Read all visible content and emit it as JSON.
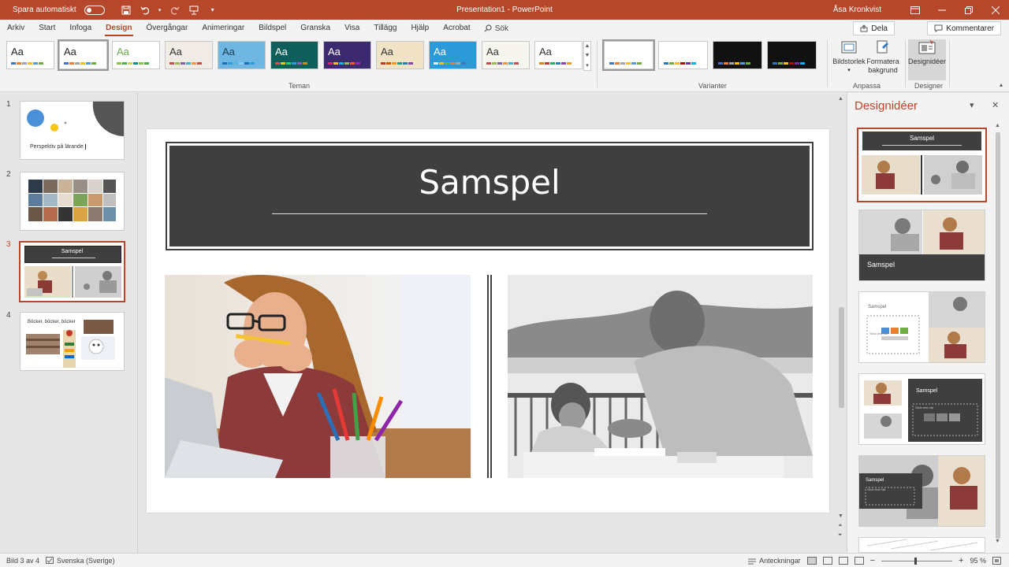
{
  "titlebar": {
    "autosave_label": "Spara automatiskt",
    "document_title": "Presentation1 - PowerPoint",
    "user": "Åsa Kronkvist",
    "icons": [
      "save-icon",
      "undo-icon",
      "redo-icon",
      "present-icon",
      "customize-icon",
      "ribbon-display-icon",
      "minimize-icon",
      "restore-icon",
      "close-icon"
    ]
  },
  "tabs": [
    "Arkiv",
    "Start",
    "Infoga",
    "Design",
    "Övergångar",
    "Animeringar",
    "Bildspel",
    "Granska",
    "Visa",
    "Tillägg",
    "Hjälp",
    "Acrobat"
  ],
  "active_tab": "Design",
  "search_label": "Sök",
  "share_label": "Dela",
  "comments_label": "Kommentarer",
  "ribbon": {
    "themes_group_label": "Teman",
    "variants_group_label": "Varianter",
    "customize_group_label": "Anpassa",
    "designer_group_label": "Designer",
    "theme_sample_text": "Aa",
    "slide_size_label": "Bildstorlek",
    "format_bg_label_1": "Formatera",
    "format_bg_label_2": "bakgrund",
    "design_ideas_btn_label": "Designidéer",
    "themes": [
      {
        "bg": "#ffffff",
        "fg": "#222222",
        "bars": [
          "#4472c4",
          "#ed7d31",
          "#a5a5a5",
          "#ffc000",
          "#5b9bd5",
          "#70ad47"
        ]
      },
      {
        "bg": "#ffffff",
        "fg": "#222222",
        "bars": [
          "#4472c4",
          "#ed7d31",
          "#a5a5a5",
          "#ffc000",
          "#5b9bd5",
          "#70ad47"
        ]
      },
      {
        "bg": "#ffffff",
        "fg": "#6aa84f",
        "bars": [
          "#8bc34a",
          "#4caf50",
          "#cddc39",
          "#009688",
          "#8bc34a",
          "#4caf50"
        ]
      },
      {
        "bg": "#f0ebe4",
        "fg": "#333333",
        "bars": [
          "#c0504d",
          "#9bbb59",
          "#8064a2",
          "#4bacc6",
          "#f79646",
          "#c0504d"
        ]
      },
      {
        "bg": "#6fb7e3",
        "fg": "#1f3b57",
        "bars": [
          "#1f6fb2",
          "#2e9cd8",
          "#56b3e6",
          "#86c9ef",
          "#1f6fb2",
          "#2e9cd8"
        ]
      },
      {
        "bg": "#0f5e5b",
        "fg": "#ffffff",
        "bars": [
          "#e74c3c",
          "#f1c40f",
          "#2ecc71",
          "#3498db",
          "#9b59b6",
          "#e67e22"
        ]
      },
      {
        "bg": "#3b2a6e",
        "fg": "#ffffff",
        "bars": [
          "#e91e63",
          "#ffc107",
          "#00bcd4",
          "#8bc34a",
          "#ff5722",
          "#9c27b0"
        ]
      },
      {
        "bg": "#f1e3c6",
        "fg": "#333333",
        "bars": [
          "#c0392b",
          "#d35400",
          "#f39c12",
          "#16a085",
          "#2980b9",
          "#8e44ad"
        ]
      },
      {
        "bg": "#2d9ad8",
        "fg": "#ffffff",
        "bars": [
          "#e8f1f8",
          "#ffc000",
          "#70ad47",
          "#ed7d31",
          "#a5a5a5",
          "#4472c4"
        ]
      },
      {
        "bg": "#f6f6ef",
        "fg": "#333333",
        "bars": [
          "#c0504d",
          "#9bbb59",
          "#8064a2",
          "#f79646",
          "#4bacc6",
          "#c0504d"
        ]
      },
      {
        "bg": "#ffffff",
        "fg": "#333333",
        "bars": [
          "#e67e22",
          "#c0392b",
          "#27ae60",
          "#2980b9",
          "#8e44ad",
          "#f39c12"
        ]
      }
    ],
    "variants": [
      {
        "bg": "#ffffff",
        "bars": [
          "#4472c4",
          "#ed7d31",
          "#a5a5a5",
          "#ffc000",
          "#5b9bd5",
          "#70ad47"
        ]
      },
      {
        "bg": "#ffffff",
        "bars": [
          "#2e75b6",
          "#70ad47",
          "#ffc000",
          "#c00000",
          "#7030a0",
          "#00b0f0"
        ]
      },
      {
        "bg": "#111111",
        "bars": [
          "#4472c4",
          "#ed7d31",
          "#a5a5a5",
          "#ffc000",
          "#5b9bd5",
          "#70ad47"
        ]
      },
      {
        "bg": "#111111",
        "bars": [
          "#2e75b6",
          "#70ad47",
          "#ffc000",
          "#c00000",
          "#7030a0",
          "#00b0f0"
        ]
      }
    ]
  },
  "slides": [
    {
      "number": "1",
      "text": "Perspektiv på lärande"
    },
    {
      "number": "2",
      "text": ""
    },
    {
      "number": "3",
      "text": "Samspel"
    },
    {
      "number": "4",
      "text": "Böcker, böcker, böcker"
    }
  ],
  "current_slide": {
    "title": "Samspel"
  },
  "designer": {
    "title": "Designidéer",
    "idea_title": "Samspel",
    "idea_placeholder_text": "Skriv text här"
  },
  "status": {
    "slide_position": "Bild 3 av 4",
    "language": "Svenska (Sverige)",
    "notes_label": "Anteckningar",
    "zoom": "95 %"
  },
  "colors": {
    "accent": "#b7472a",
    "title_box": "#3f3f3f"
  }
}
